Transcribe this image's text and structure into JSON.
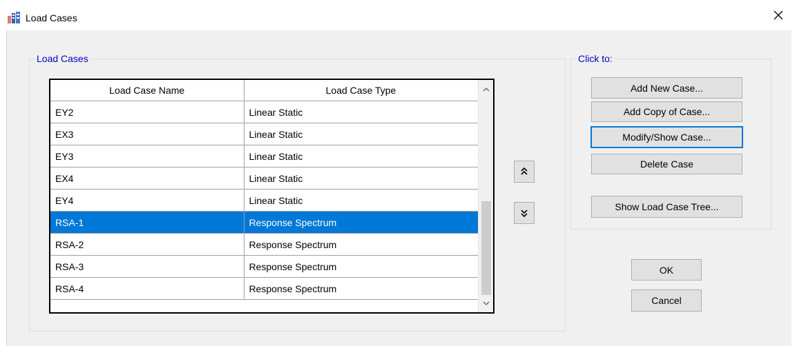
{
  "window": {
    "title": "Load Cases"
  },
  "load_cases_group": {
    "legend": "Load Cases"
  },
  "table": {
    "headers": [
      "Load Case Name",
      "Load Case Type"
    ],
    "rows": [
      {
        "name": "EY2",
        "type": "Linear Static",
        "selected": false
      },
      {
        "name": "EX3",
        "type": "Linear Static",
        "selected": false
      },
      {
        "name": "EY3",
        "type": "Linear Static",
        "selected": false
      },
      {
        "name": "EX4",
        "type": "Linear Static",
        "selected": false
      },
      {
        "name": "EY4",
        "type": "Linear Static",
        "selected": false
      },
      {
        "name": "RSA-1",
        "type": "Response Spectrum",
        "selected": true
      },
      {
        "name": "RSA-2",
        "type": "Response Spectrum",
        "selected": false
      },
      {
        "name": "RSA-3",
        "type": "Response Spectrum",
        "selected": false
      },
      {
        "name": "RSA-4",
        "type": "Response Spectrum",
        "selected": false
      }
    ]
  },
  "click_to_group": {
    "legend": "Click to:",
    "add_new": "Add New Case...",
    "add_copy": "Add Copy of Case...",
    "modify_show": "Modify/Show Case...",
    "delete": "Delete Case",
    "show_tree": "Show Load Case Tree..."
  },
  "dialog_buttons": {
    "ok": "OK",
    "cancel": "Cancel"
  },
  "colors": {
    "selection": "#0078d7",
    "legend_text": "#0000c8",
    "focus_border": "#0078d7"
  },
  "icons": {
    "app": "etabs-app-icon",
    "close": "close-icon",
    "move_up": "double-chevron-up-icon",
    "move_down": "double-chevron-down-icon"
  }
}
